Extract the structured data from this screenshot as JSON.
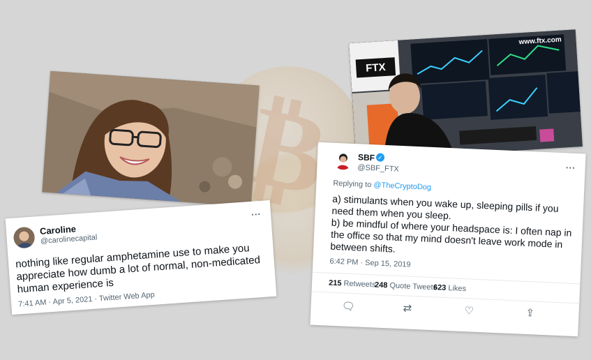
{
  "caroline_tweet": {
    "name": "Caroline",
    "handle": "@carolinecapital",
    "more": "...",
    "text": "nothing like regular amphetamine use to make you appreciate how dumb a lot of normal, non-medicated human experience is",
    "meta": "7:41 AM · Apr 5, 2021 · Twitter Web App"
  },
  "sbf_tweet": {
    "name": "SBF",
    "handle": "@SBF_FTX",
    "more": "...",
    "replying_prefix": "Replying to ",
    "replying_handle": "@TheCryptoDog",
    "text_a": "a) stimulants when you wake up, sleeping pills if you need them when you sleep.",
    "text_b": "b) be mindful of where your headspace is: I often nap in the office so that my mind doesn't leave work mode in between shifts.",
    "meta": "6:42 PM · Sep 15, 2019",
    "stats": {
      "retweets_count": "215",
      "retweets_label": "Retweets",
      "quote_count": "248",
      "quote_label": "Quote Tweets",
      "likes_count": "623",
      "likes_label": "Likes"
    },
    "actions": {
      "reply": "reply-icon",
      "retweet": "retweet-icon",
      "like": "heart-icon",
      "share": "share-icon"
    }
  },
  "photo_sbf": {
    "logo": "FTX",
    "screen_url": "www.ftx.com"
  },
  "colors": {
    "link": "#1d9bf0",
    "verified": "#1d9bf0",
    "background": "#d6d6d6",
    "ftx_teal": "#5fcade"
  }
}
